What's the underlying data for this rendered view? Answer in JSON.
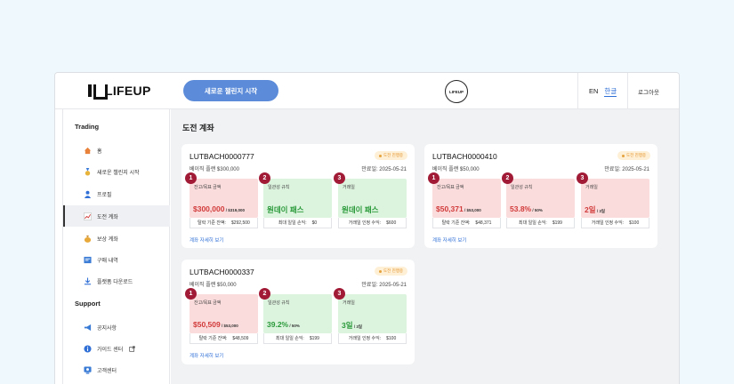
{
  "header": {
    "logo_text": "LIFEUP",
    "start_button": "새로운 챌린지 시작",
    "center_logo": "LIFEUP",
    "lang_en": "EN",
    "lang_ko": "한글",
    "logout": "로그아웃"
  },
  "sidebar": {
    "trading_title": "Trading",
    "trading_items": [
      {
        "label": "홈",
        "icon": "home-icon"
      },
      {
        "label": "새로운 챌린지 시작",
        "icon": "medal-icon"
      },
      {
        "label": "프로필",
        "icon": "user-icon"
      },
      {
        "label": "도전 계좌",
        "icon": "chart-icon"
      },
      {
        "label": "보상 계좌",
        "icon": "money-bag-icon"
      },
      {
        "label": "구매 내역",
        "icon": "receipt-icon"
      },
      {
        "label": "플랫폼 다운로드",
        "icon": "download-icon"
      }
    ],
    "support_title": "Support",
    "support_items": [
      {
        "label": "공지사항",
        "icon": "megaphone-icon"
      },
      {
        "label": "가이드 센터",
        "icon": "info-icon"
      },
      {
        "label": "고객센터",
        "icon": "support-icon"
      }
    ]
  },
  "main": {
    "title": "도전 계좌",
    "cards": [
      {
        "account": "LUTBACH0000777",
        "status": "도전 진행중",
        "plan": "베이직 플랜 $300,000",
        "expiry": "만료일: 2025-05-21",
        "stats": [
          {
            "num": "1",
            "label": "잔고/목표 금액",
            "value": "$300,000",
            "sub": " / $319,000",
            "foot1": "탈락 기준 잔액:",
            "foot2": "$292,500",
            "tone": "red"
          },
          {
            "num": "2",
            "label": "일관성 규칙",
            "value": "원데이 패스",
            "sub": "",
            "foot1": "최대 일일 손익:",
            "foot2": "$0",
            "tone": "green"
          },
          {
            "num": "3",
            "label": "거래일",
            "value": "원데이 패스",
            "sub": "",
            "foot1": "거래일 인정 수익:",
            "foot2": "$600",
            "tone": "green"
          }
        ],
        "link": "계좌 자세히 보기"
      },
      {
        "account": "LUTBACH0000410",
        "status": "도전 진행중",
        "plan": "베이직 플랜 $50,000",
        "expiry": "만료일: 2025-05-21",
        "stats": [
          {
            "num": "1",
            "label": "잔고/목표 금액",
            "value": "$50,371",
            "sub": " / $53,000",
            "foot1": "탈락 기준 잔액:",
            "foot2": "$48,371",
            "tone": "red"
          },
          {
            "num": "2",
            "label": "일관성 규칙",
            "value": "53.8%",
            "sub": " / 50%",
            "foot1": "최대 일일 손익:",
            "foot2": "$199",
            "tone": "red"
          },
          {
            "num": "3",
            "label": "거래일",
            "value": "2일",
            "sub": " / 3일",
            "foot1": "거래일 인정 수익:",
            "foot2": "$100",
            "tone": "red"
          }
        ],
        "link": "계좌 자세히 보기"
      },
      {
        "account": "LUTBACH0000337",
        "status": "도전 진행중",
        "plan": "베이직 플랜 $50,000",
        "expiry": "만료일: 2025-05-21",
        "stats": [
          {
            "num": "1",
            "label": "잔고/목표 금액",
            "value": "$50,509",
            "sub": " / $53,000",
            "foot1": "탈락 기준 잔액:",
            "foot2": "$48,509",
            "tone": "red"
          },
          {
            "num": "2",
            "label": "일관성 규칙",
            "value": "39.2%",
            "sub": " / 50%",
            "foot1": "최대 일일 손익:",
            "foot2": "$199",
            "tone": "green"
          },
          {
            "num": "3",
            "label": "거래일",
            "value": "3일",
            "sub": " / 3일",
            "foot1": "거래일 인정 수익:",
            "foot2": "$100",
            "tone": "green"
          }
        ],
        "link": "계좌 자세히 보기"
      }
    ]
  }
}
